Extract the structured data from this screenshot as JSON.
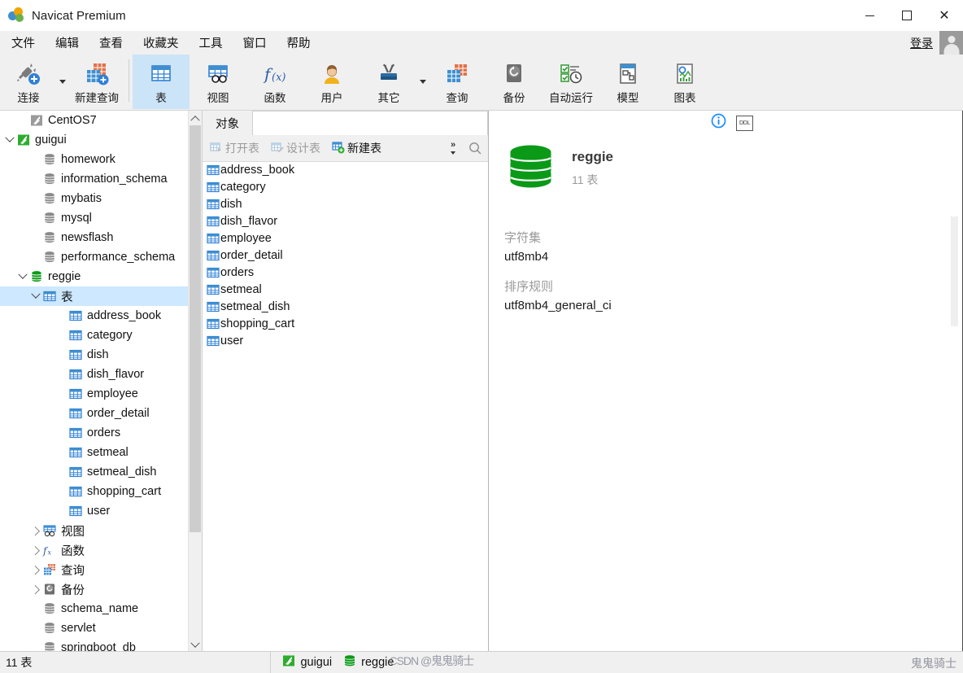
{
  "window": {
    "title": "Navicat Premium",
    "logo_icon": "navicat-logo-icon",
    "minimize_label": "—",
    "maximize_label": "□",
    "close_label": "✕"
  },
  "menubar": {
    "items": [
      {
        "label": "文件"
      },
      {
        "label": "编辑"
      },
      {
        "label": "查看"
      },
      {
        "label": "收藏夹"
      },
      {
        "label": "工具"
      },
      {
        "label": "窗口"
      },
      {
        "label": "帮助"
      }
    ],
    "login_label": "登录",
    "avatar_icon": "user-avatar-icon"
  },
  "ribbon": {
    "items": [
      {
        "label": "连接",
        "icon": "connection-icon",
        "active": false,
        "has_caret": true
      },
      {
        "label": "新建查询",
        "icon": "new-query-icon",
        "active": false,
        "has_caret": false
      },
      {
        "label": "表",
        "icon": "table-icon",
        "active": true,
        "has_caret": false
      },
      {
        "label": "视图",
        "icon": "view-icon",
        "active": false,
        "has_caret": false
      },
      {
        "label": "函数",
        "icon": "function-icon",
        "active": false,
        "has_caret": false
      },
      {
        "label": "用户",
        "icon": "user-icon",
        "active": false,
        "has_caret": false
      },
      {
        "label": "其它",
        "icon": "other-tools-icon",
        "active": false,
        "has_caret": true
      },
      {
        "label": "查询",
        "icon": "query-icon",
        "active": false,
        "has_caret": false
      },
      {
        "label": "备份",
        "icon": "backup-icon",
        "active": false,
        "has_caret": false
      },
      {
        "label": "自动运行",
        "icon": "automation-icon",
        "active": false,
        "has_caret": false
      },
      {
        "label": "模型",
        "icon": "model-icon",
        "active": false,
        "has_caret": false
      },
      {
        "label": "图表",
        "icon": "chart-icon",
        "active": false,
        "has_caret": false
      }
    ]
  },
  "sidebar": {
    "scroll": {
      "up_icon": "scroll-up-icon",
      "down_icon": "scroll-down-icon"
    },
    "nodes": [
      {
        "label": "CentOS7",
        "icon": "connection-closed-icon",
        "indent": 1,
        "twist": "none",
        "selected": false
      },
      {
        "label": "guigui",
        "icon": "connection-open-icon",
        "indent": 0,
        "twist": "open",
        "selected": false
      },
      {
        "label": "homework",
        "icon": "database-gray-icon",
        "indent": 2,
        "twist": "none",
        "selected": false
      },
      {
        "label": "information_schema",
        "icon": "database-gray-icon",
        "indent": 2,
        "twist": "none",
        "selected": false
      },
      {
        "label": "mybatis",
        "icon": "database-gray-icon",
        "indent": 2,
        "twist": "none",
        "selected": false
      },
      {
        "label": "mysql",
        "icon": "database-gray-icon",
        "indent": 2,
        "twist": "none",
        "selected": false
      },
      {
        "label": "newsflash",
        "icon": "database-gray-icon",
        "indent": 2,
        "twist": "none",
        "selected": false
      },
      {
        "label": "performance_schema",
        "icon": "database-gray-icon",
        "indent": 2,
        "twist": "none",
        "selected": false
      },
      {
        "label": "reggie",
        "icon": "database-green-icon",
        "indent": 1,
        "twist": "open",
        "selected": false
      },
      {
        "label": "表",
        "icon": "table-folder-icon",
        "indent": 2,
        "twist": "open",
        "selected": true
      },
      {
        "label": "address_book",
        "icon": "table-icon",
        "indent": 4,
        "twist": "none",
        "selected": false
      },
      {
        "label": "category",
        "icon": "table-icon",
        "indent": 4,
        "twist": "none",
        "selected": false
      },
      {
        "label": "dish",
        "icon": "table-icon",
        "indent": 4,
        "twist": "none",
        "selected": false
      },
      {
        "label": "dish_flavor",
        "icon": "table-icon",
        "indent": 4,
        "twist": "none",
        "selected": false
      },
      {
        "label": "employee",
        "icon": "table-icon",
        "indent": 4,
        "twist": "none",
        "selected": false
      },
      {
        "label": "order_detail",
        "icon": "table-icon",
        "indent": 4,
        "twist": "none",
        "selected": false
      },
      {
        "label": "orders",
        "icon": "table-icon",
        "indent": 4,
        "twist": "none",
        "selected": false
      },
      {
        "label": "setmeal",
        "icon": "table-icon",
        "indent": 4,
        "twist": "none",
        "selected": false
      },
      {
        "label": "setmeal_dish",
        "icon": "table-icon",
        "indent": 4,
        "twist": "none",
        "selected": false
      },
      {
        "label": "shopping_cart",
        "icon": "table-icon",
        "indent": 4,
        "twist": "none",
        "selected": false
      },
      {
        "label": "user",
        "icon": "table-icon",
        "indent": 4,
        "twist": "none",
        "selected": false
      },
      {
        "label": "视图",
        "icon": "view-folder-icon",
        "indent": 2,
        "twist": "closed",
        "selected": false
      },
      {
        "label": "函数",
        "icon": "function-folder-icon",
        "indent": 2,
        "twist": "closed",
        "selected": false
      },
      {
        "label": "查询",
        "icon": "query-folder-icon",
        "indent": 2,
        "twist": "closed",
        "selected": false
      },
      {
        "label": "备份",
        "icon": "backup-folder-icon",
        "indent": 2,
        "twist": "closed",
        "selected": false
      },
      {
        "label": "schema_name",
        "icon": "database-gray-icon",
        "indent": 2,
        "twist": "none",
        "selected": false
      },
      {
        "label": "servlet",
        "icon": "database-gray-icon",
        "indent": 2,
        "twist": "none",
        "selected": false
      },
      {
        "label": "springboot_db",
        "icon": "database-gray-icon",
        "indent": 2,
        "twist": "none",
        "selected": false
      }
    ]
  },
  "objectpane": {
    "tab_label": "对象",
    "toolbar": {
      "open_table": "打开表",
      "design_table": "设计表",
      "new_table": "新建表",
      "overflow_icon": "chevron-double-right-icon",
      "search_icon": "search-icon"
    },
    "tables": [
      {
        "name": "address_book"
      },
      {
        "name": "category"
      },
      {
        "name": "dish"
      },
      {
        "name": "dish_flavor"
      },
      {
        "name": "employee"
      },
      {
        "name": "order_detail"
      },
      {
        "name": "orders"
      },
      {
        "name": "setmeal"
      },
      {
        "name": "setmeal_dish"
      },
      {
        "name": "shopping_cart"
      },
      {
        "name": "user"
      }
    ]
  },
  "infopane": {
    "info_icon": "info-circle-icon",
    "ddl_label": "DDL",
    "db_icon": "database-green-large-icon",
    "db_name": "reggie",
    "db_count": "11 表",
    "fields": [
      {
        "label": "字符集",
        "value": "utf8mb4"
      },
      {
        "label": "排序规则",
        "value": "utf8mb4_general_ci"
      }
    ]
  },
  "statusbar": {
    "left_text": "11 表",
    "connection": {
      "icon": "connection-open-icon",
      "label": "guigui"
    },
    "database": {
      "icon": "database-green-icon",
      "label": "reggie"
    },
    "watermark_a": "CSDN @鬼鬼骑士",
    "watermark_b": "鬼鬼骑士"
  },
  "colors": {
    "accent_blue": "#2f80d6",
    "green": "#1a9e1a",
    "selection": "#cde8ff",
    "chrome": "#f0f0f0"
  }
}
